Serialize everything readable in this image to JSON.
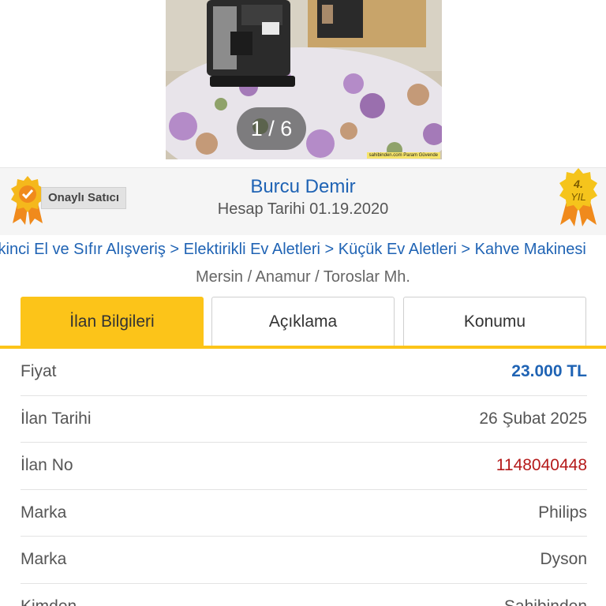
{
  "gallery": {
    "counter": "1 / 6",
    "watermark": "sahibinden.com Param Güvende"
  },
  "seller": {
    "badge_label": "Onaylı Satıcı",
    "name": "Burcu Demir",
    "account_date": "Hesap Tarihi  01.19.2020",
    "years_badge_number": "4.",
    "years_badge_text": "YIL"
  },
  "breadcrumb": {
    "text": "İkinci El ve Sıfır Alışveriş > Elektirikli Ev Aletleri > Küçük Ev Aletleri > Kahve Makinesi"
  },
  "location": "Mersin / Anamur / Toroslar Mh.",
  "tabs": [
    {
      "label": "İlan Bilgileri",
      "active": true
    },
    {
      "label": "Açıklama",
      "active": false
    },
    {
      "label": "Konumu",
      "active": false
    }
  ],
  "details": [
    {
      "key": "Fiyat",
      "value": "23.000 TL"
    },
    {
      "key": "İlan Tarihi",
      "value": "26 Şubat 2025"
    },
    {
      "key": "İlan No",
      "value": "1148040448"
    },
    {
      "key": "Marka",
      "value": "Philips"
    },
    {
      "key": "Marka",
      "value": "Dyson"
    },
    {
      "key": "Kimden",
      "value": "Sahibinden"
    }
  ],
  "colors": {
    "accent_yellow": "#fcc419",
    "link_blue": "#1f63b4",
    "id_red": "#b51a1a"
  }
}
